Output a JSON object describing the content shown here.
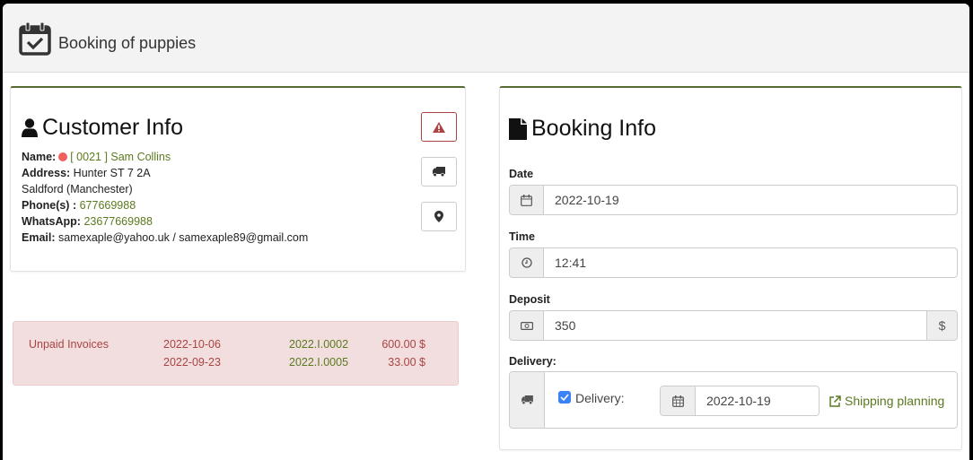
{
  "header": {
    "title": "Booking of puppies",
    "icon": "calendar-check-icon"
  },
  "customer": {
    "title": "Customer Info",
    "icon": "user-icon",
    "name_label": "Name:",
    "name_value": "[ 0021 ] Sam Collins",
    "status_color": "#f0605d",
    "address_label": "Address:",
    "address_line1": "Hunter ST 7 2A",
    "address_line2": "Saldford (Manchester)",
    "phone_label": "Phone(s) :",
    "phone_value": "677669988",
    "whatsapp_label": "WhatsApp:",
    "whatsapp_value": "23677669988",
    "email_label": "Email:",
    "email_value": "samexaple@yahoo.uk / samexaple89@gmail.com",
    "buttons": [
      {
        "icon": "warning-icon"
      },
      {
        "icon": "truck-icon"
      },
      {
        "icon": "map-marker-icon"
      }
    ]
  },
  "unpaid": {
    "label": "Unpaid Invoices",
    "invoices": [
      {
        "date": "2022-10-06",
        "number": "2022.I.0002",
        "amount": "600.00 $"
      },
      {
        "date": "2022-09-23",
        "number": "2022.I.0005",
        "amount": "33.00 $"
      }
    ]
  },
  "booking": {
    "title": "Booking Info",
    "icon": "file-icon",
    "date_label": "Date",
    "date_value": "2022-10-19",
    "time_label": "Time",
    "time_value": "12:41",
    "deposit_label": "Deposit",
    "deposit_value": "350",
    "deposit_currency": "$",
    "delivery_label": "Delivery:",
    "delivery_checkbox_label": "Delivery:",
    "delivery_checked": true,
    "delivery_date": "2022-10-19",
    "shipping_link": "Shipping planning"
  },
  "colors": {
    "accent": "#556b2f",
    "link_green": "#5a7a1e",
    "danger": "#a94442",
    "alert_bg": "#f2dede",
    "checkbox": "#3b82f6"
  }
}
